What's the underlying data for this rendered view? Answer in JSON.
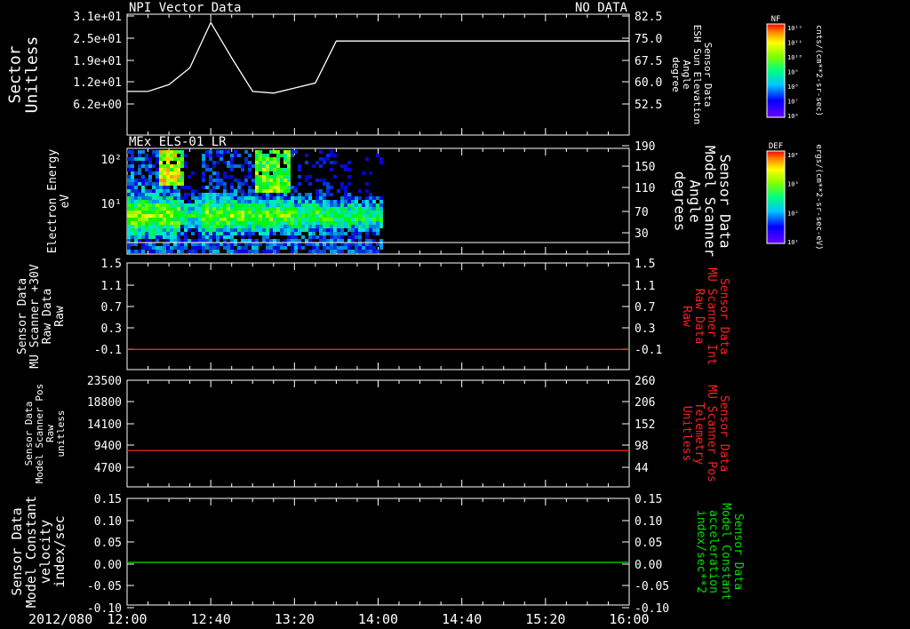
{
  "colors": {
    "background": "#000000",
    "foreground": "#ffffff",
    "red": "#ff2020",
    "green": "#00e000"
  },
  "footer": {
    "date_label": "2012/080",
    "x_ticks": [
      "12:00",
      "12:40",
      "13:20",
      "14:00",
      "14:40",
      "15:20",
      "16:00"
    ]
  },
  "chart_data": [
    {
      "type": "line",
      "title": "NPI Vector Data",
      "status": "NO DATA",
      "left_axis": {
        "label_lines": [
          "Sector",
          "Unitless"
        ],
        "ticks": [
          "3.1e+01",
          "2.5e+01",
          "1.9e+01",
          "1.2e+01",
          "6.2e+00"
        ]
      },
      "right_axis": {
        "label_lines": [
          "Sensor Data",
          "ESH Sun Elevation",
          "Angle",
          "degree"
        ],
        "ticks": [
          "82.5",
          "75.0",
          "67.5",
          "60.0",
          "52.5"
        ],
        "ylim": [
          47,
          83
        ]
      },
      "series": [
        {
          "x": [
            "12:00",
            "12:10",
            "12:20",
            "12:30",
            "12:40",
            "12:50",
            "13:00",
            "13:10",
            "13:20",
            "13:30",
            "13:40",
            "13:50",
            "14:00",
            "16:00"
          ],
          "values": [
            60,
            60,
            62,
            67,
            80.5,
            70,
            60,
            59.5,
            61,
            62.5,
            75,
            75,
            75,
            75
          ]
        }
      ]
    },
    {
      "type": "heatmap",
      "title": "MEx ELS-01 LR",
      "left_axis": {
        "label_lines": [
          "Electron Energy",
          "eV"
        ],
        "ticks": [
          "10²",
          "10¹"
        ],
        "scale": "log"
      },
      "right_axis": {
        "label_lines": [
          "Sensor Data",
          "Model Scanner",
          "Angle",
          "degrees"
        ],
        "ticks": [
          "190",
          "150",
          "110",
          "70",
          "30"
        ]
      },
      "data_extent": [
        "12:00",
        "14:02"
      ],
      "overlay_line_value": 10
    },
    {
      "type": "line",
      "left_axis": {
        "label_lines": [
          "Sensor Data",
          "MU Scanner +30V",
          "Raw Data",
          "Raw"
        ],
        "ticks": [
          "1.5",
          "1.1",
          "0.7",
          "0.3",
          "-0.1"
        ],
        "ylim": [
          -0.35,
          1.5
        ]
      },
      "right_axis": {
        "label_lines": [
          "Sensor Data",
          "MU Scanner Int",
          "Raw Data",
          "Raw"
        ],
        "ticks": [
          "1.5",
          "1.1",
          "0.7",
          "0.3",
          "-0.1"
        ]
      },
      "series": [
        {
          "name": "Sensor Data MU Scanner Int Raw Data Raw",
          "color": "#ff2020",
          "constant": 0.0
        }
      ]
    },
    {
      "type": "line",
      "left_axis": {
        "label_lines": [
          "Sensor Data",
          "Model Scanner Pos",
          "Raw",
          "unitless"
        ],
        "ticks": [
          "23500",
          "18800",
          "14100",
          "9400",
          "4700"
        ],
        "ylim": [
          0,
          23500
        ]
      },
      "right_axis": {
        "label_lines": [
          "Sensor Data",
          "MU Scanner Pos",
          "Telemetry",
          "Unitless"
        ],
        "ticks": [
          "260",
          "206",
          "152",
          "98",
          "44"
        ]
      },
      "series": [
        {
          "name": "Sensor Data MU Scanner Pos Telemetry Unitless",
          "color": "#ff2020",
          "constant": 8000
        }
      ]
    },
    {
      "type": "line",
      "left_axis": {
        "label_lines": [
          "Sensor Data",
          "Model Constant",
          "velocity",
          "index/sec"
        ],
        "ticks": [
          "0.15",
          "0.10",
          "0.05",
          "0.00",
          "-0.05",
          "-0.10"
        ],
        "ylim": [
          -0.1,
          0.15
        ]
      },
      "right_axis": {
        "label_lines": [
          "Sensor Data",
          "Model Constant",
          "acceleration",
          "index/sec**2"
        ],
        "ticks": [
          "0.15",
          "0.10",
          "0.05",
          "0.00",
          "-0.05",
          "-0.10"
        ]
      },
      "series": [
        {
          "name": "Sensor Data Model Constant acceleration index/sec**2",
          "color": "#00e000",
          "constant": 0.0
        }
      ]
    }
  ],
  "colorbars": [
    {
      "name": "NF",
      "unit": "cnts/(cm**2-sr-sec)",
      "ticks": [
        "10¹²",
        "10¹¹",
        "10¹⁰",
        "10⁹",
        "10⁸",
        "10⁷",
        "10⁶"
      ]
    },
    {
      "name": "DEF",
      "unit": "ergs/(cm**2-sr-sec-eV)",
      "ticks": [
        "10⁴",
        "10³",
        "10²",
        "10¹"
      ]
    }
  ]
}
